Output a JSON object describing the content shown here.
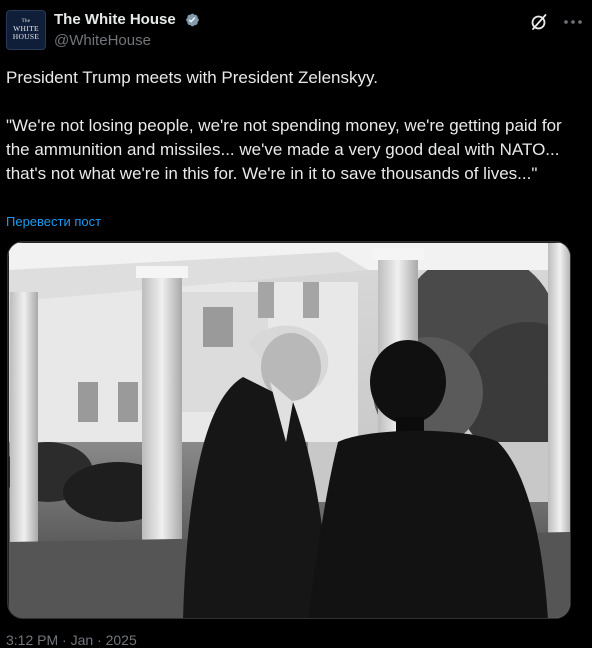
{
  "tweet": {
    "author": {
      "display_name": "The White House",
      "handle": "@WhiteHouse",
      "avatar_text": [
        "The",
        "WHITE",
        "HOUSE"
      ],
      "verified": true,
      "badge_color": "#829aab"
    },
    "body_line1": "President Trump meets with President Zelenskyy.",
    "body_quote": "\"We're not losing people, we're not spending money, we're getting paid for the ammunition and missiles... we've made a very good deal with NATO... that's not what we're in this for. We're in it to save thousands of lives...\"",
    "translate_label": "Перевести пост",
    "meta_partial": "3:12 PM · Jan · 2025",
    "icons": {
      "grok": "grok-icon",
      "more": "more-icon"
    },
    "photo_theme": "black-and-white"
  }
}
